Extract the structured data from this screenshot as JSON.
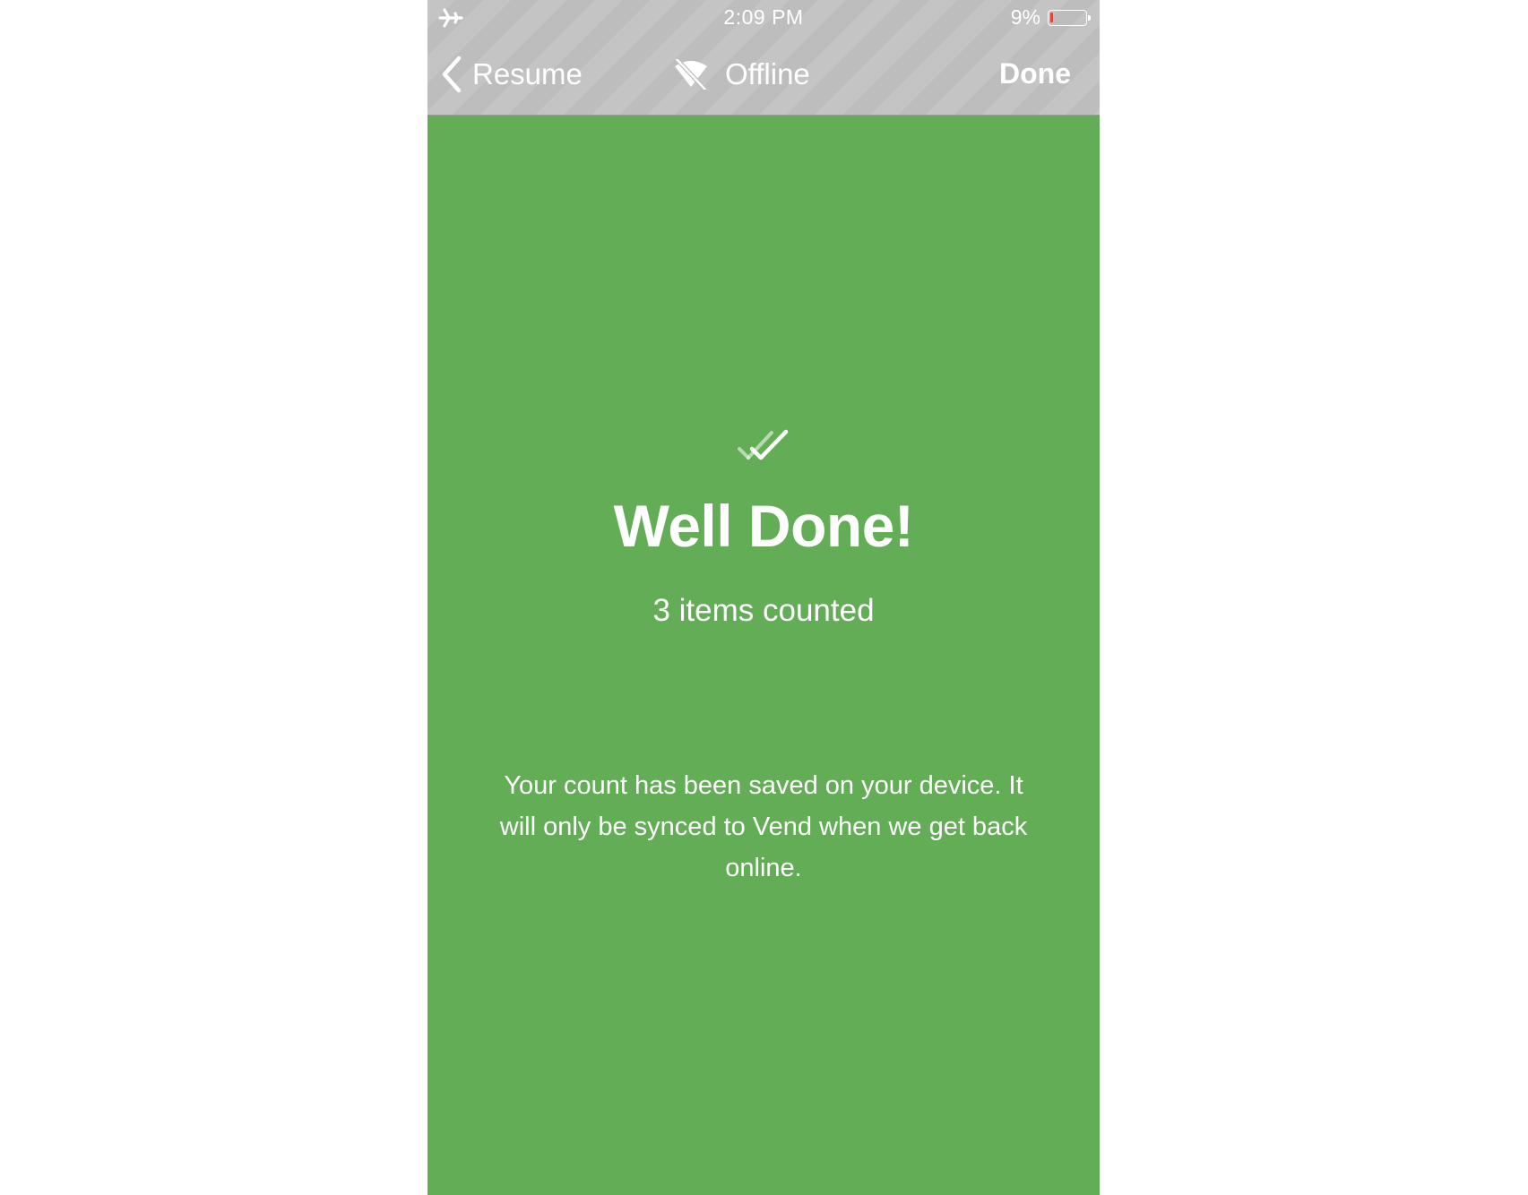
{
  "status_bar": {
    "time": "2:09 PM",
    "battery_percent": "9%",
    "battery_level": 0.09,
    "airplane_mode_icon": "airplane-icon"
  },
  "nav": {
    "back_label": "Resume",
    "title": "Offline",
    "title_icon": "wifi-off-icon",
    "done_label": "Done"
  },
  "summary": {
    "icon": "double-check-icon",
    "headline": "Well Done!",
    "count_text": "3 items counted",
    "message": "Your count has been saved on your device. It will only be synced to Vend when we get back online."
  },
  "colors": {
    "background": "#63ad57",
    "nav_bar": "#bcbdbc",
    "battery_low": "#e1443b",
    "text": "#ffffff"
  }
}
